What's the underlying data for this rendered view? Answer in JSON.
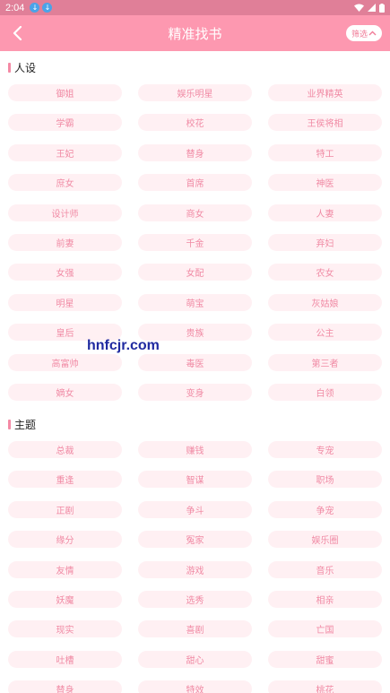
{
  "status": {
    "time": "2:04"
  },
  "header": {
    "title": "精准找书",
    "filter_label": "筛选"
  },
  "sections": [
    {
      "title": "人设",
      "tags": [
        "御姐",
        "娱乐明星",
        "业界精英",
        "学霸",
        "校花",
        "王侯将相",
        "王妃",
        "替身",
        "特工",
        "庶女",
        "首席",
        "神医",
        "设计师",
        "商女",
        "人妻",
        "前妻",
        "千金",
        "弃妇",
        "女强",
        "女配",
        "农女",
        "明星",
        "萌宝",
        "灰姑娘",
        "皇后",
        "贵族",
        "公主",
        "高富帅",
        "毒医",
        "第三者",
        "嫡女",
        "变身",
        "白领"
      ]
    },
    {
      "title": "主题",
      "tags": [
        "总裁",
        "赚钱",
        "专宠",
        "重逢",
        "智谋",
        "职场",
        "正剧",
        "争斗",
        "争宠",
        "缘分",
        "冤家",
        "娱乐圈",
        "友情",
        "游戏",
        "音乐",
        "妖魔",
        "选秀",
        "相亲",
        "现实",
        "喜剧",
        "亡国",
        "吐槽",
        "甜心",
        "甜蜜",
        "替身",
        "特效",
        "桃花"
      ]
    }
  ],
  "watermark": "hnfcjr.com"
}
